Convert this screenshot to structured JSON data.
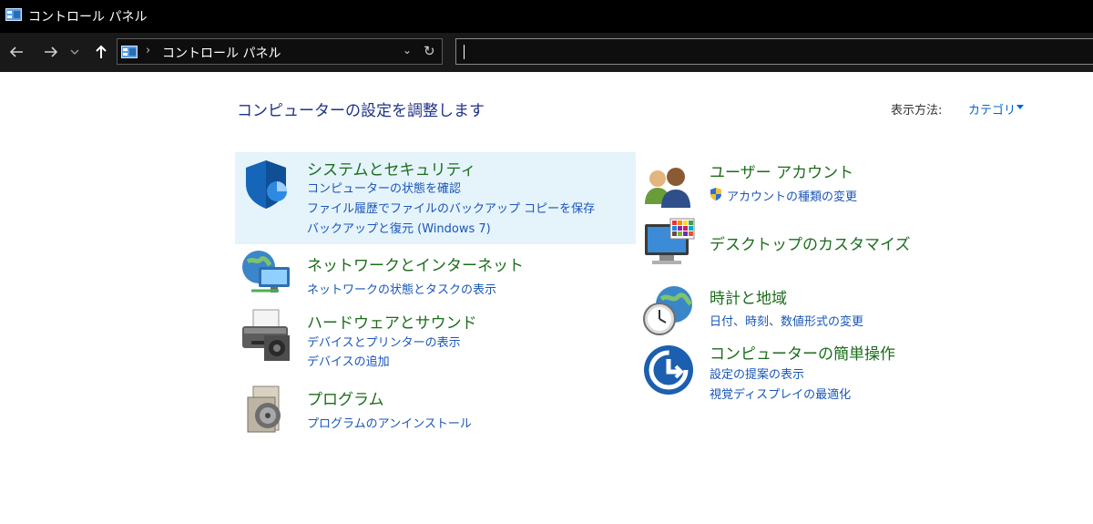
{
  "window": {
    "title": "コントロール パネル"
  },
  "nav": {
    "back_icon": "back-arrow-icon",
    "forward_icon": "forward-arrow-icon",
    "recent_icon": "chevron-down-icon",
    "up_icon": "up-arrow-icon",
    "breadcrumb": "コントロール パネル",
    "separator": "›",
    "dropdown_glyph": "⌄",
    "refresh_glyph": "↻",
    "search_value": ""
  },
  "content": {
    "page_title": "コンピューターの設定を調整します",
    "view_by_label": "表示方法:",
    "view_by_value": "カテゴリ",
    "categories": [
      {
        "title": "システムとセキュリティ",
        "icon": "shield-icon",
        "links": [
          "コンピューターの状態を確認",
          "ファイル履歴でファイルのバックアップ コピーを保存",
          "バックアップと復元 (Windows 7)"
        ]
      },
      {
        "title": "ネットワークとインターネット",
        "icon": "network-globe-icon",
        "links": [
          "ネットワークの状態とタスクの表示"
        ]
      },
      {
        "title": "ハードウェアとサウンド",
        "icon": "printer-icon",
        "links": [
          "デバイスとプリンターの表示",
          "デバイスの追加"
        ]
      },
      {
        "title": "プログラム",
        "icon": "programs-disc-icon",
        "links": [
          "プログラムのアンインストール"
        ]
      },
      {
        "title": "ユーザー アカウント",
        "icon": "users-icon",
        "links": [
          "アカウントの種類の変更"
        ]
      },
      {
        "title": "デスクトップのカスタマイズ",
        "icon": "monitor-palette-icon",
        "links": []
      },
      {
        "title": "時計と地域",
        "icon": "clock-globe-icon",
        "links": [
          "日付、時刻、数値形式の変更"
        ]
      },
      {
        "title": "コンピューターの簡単操作",
        "icon": "ease-of-access-icon",
        "links": [
          "設定の提案の表示",
          "視覚ディスプレイの最適化"
        ]
      }
    ]
  },
  "colors": {
    "title_blue": "#1e3287",
    "link_blue": "#1a56b8",
    "category_green": "#1b6d1b",
    "highlight": "#e5f3fb"
  }
}
